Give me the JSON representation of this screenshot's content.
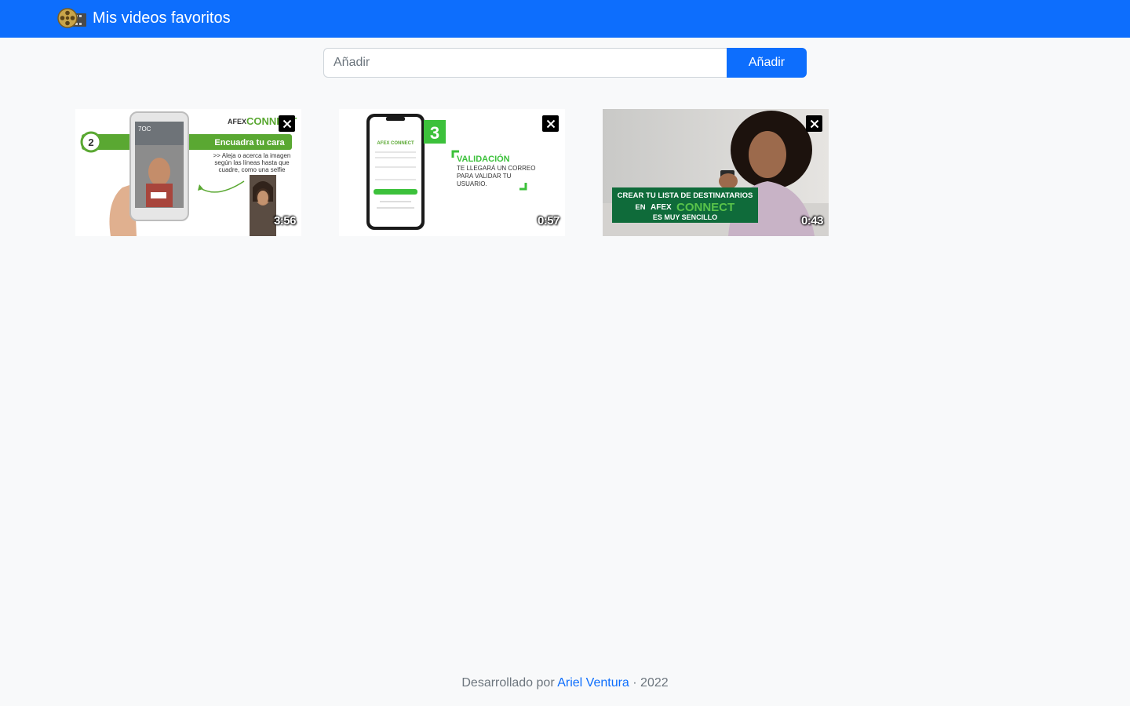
{
  "app": {
    "title": "Mis videos favoritos",
    "brand_icon": "film-reel-icon",
    "accent_color": "#0d6efd",
    "background_color": "#f8f9fa"
  },
  "form": {
    "placeholder": "Añadir",
    "value": "",
    "button_label": "Añadir"
  },
  "videos": [
    {
      "duration": "3:56",
      "close_icon": "close-icon",
      "thumbnail": {
        "step_number": "2",
        "brand": "AFEX CONNECT",
        "brand_prefix": "AFEX",
        "brand_name": "CONNECT",
        "heading": "Encuadra tu cara",
        "lines": [
          ">> Aleja o acerca la imagen",
          "según las líneas hasta que",
          "cuadre, como una selfie"
        ]
      }
    },
    {
      "duration": "0:57",
      "close_icon": "close-icon",
      "thumbnail": {
        "step_number": "3",
        "brand": "AFEX CONNECT",
        "heading": "VALIDACIÓN",
        "lines": [
          "TE LLEGARÁ UN CORREO",
          "PARA VALIDAR TU",
          "USUARIO."
        ]
      }
    },
    {
      "duration": "0:43",
      "close_icon": "close-icon",
      "thumbnail": {
        "lines": [
          "CREAR TU LISTA DE DESTINATARIOS",
          "EN",
          "ES MUY SENCILLO"
        ],
        "brand_prefix": "AFEX",
        "brand_name": "CONNECT"
      }
    }
  ],
  "footer": {
    "prefix": "Desarrollado por",
    "author": "Ariel Ventura",
    "suffix": "· 2022"
  }
}
